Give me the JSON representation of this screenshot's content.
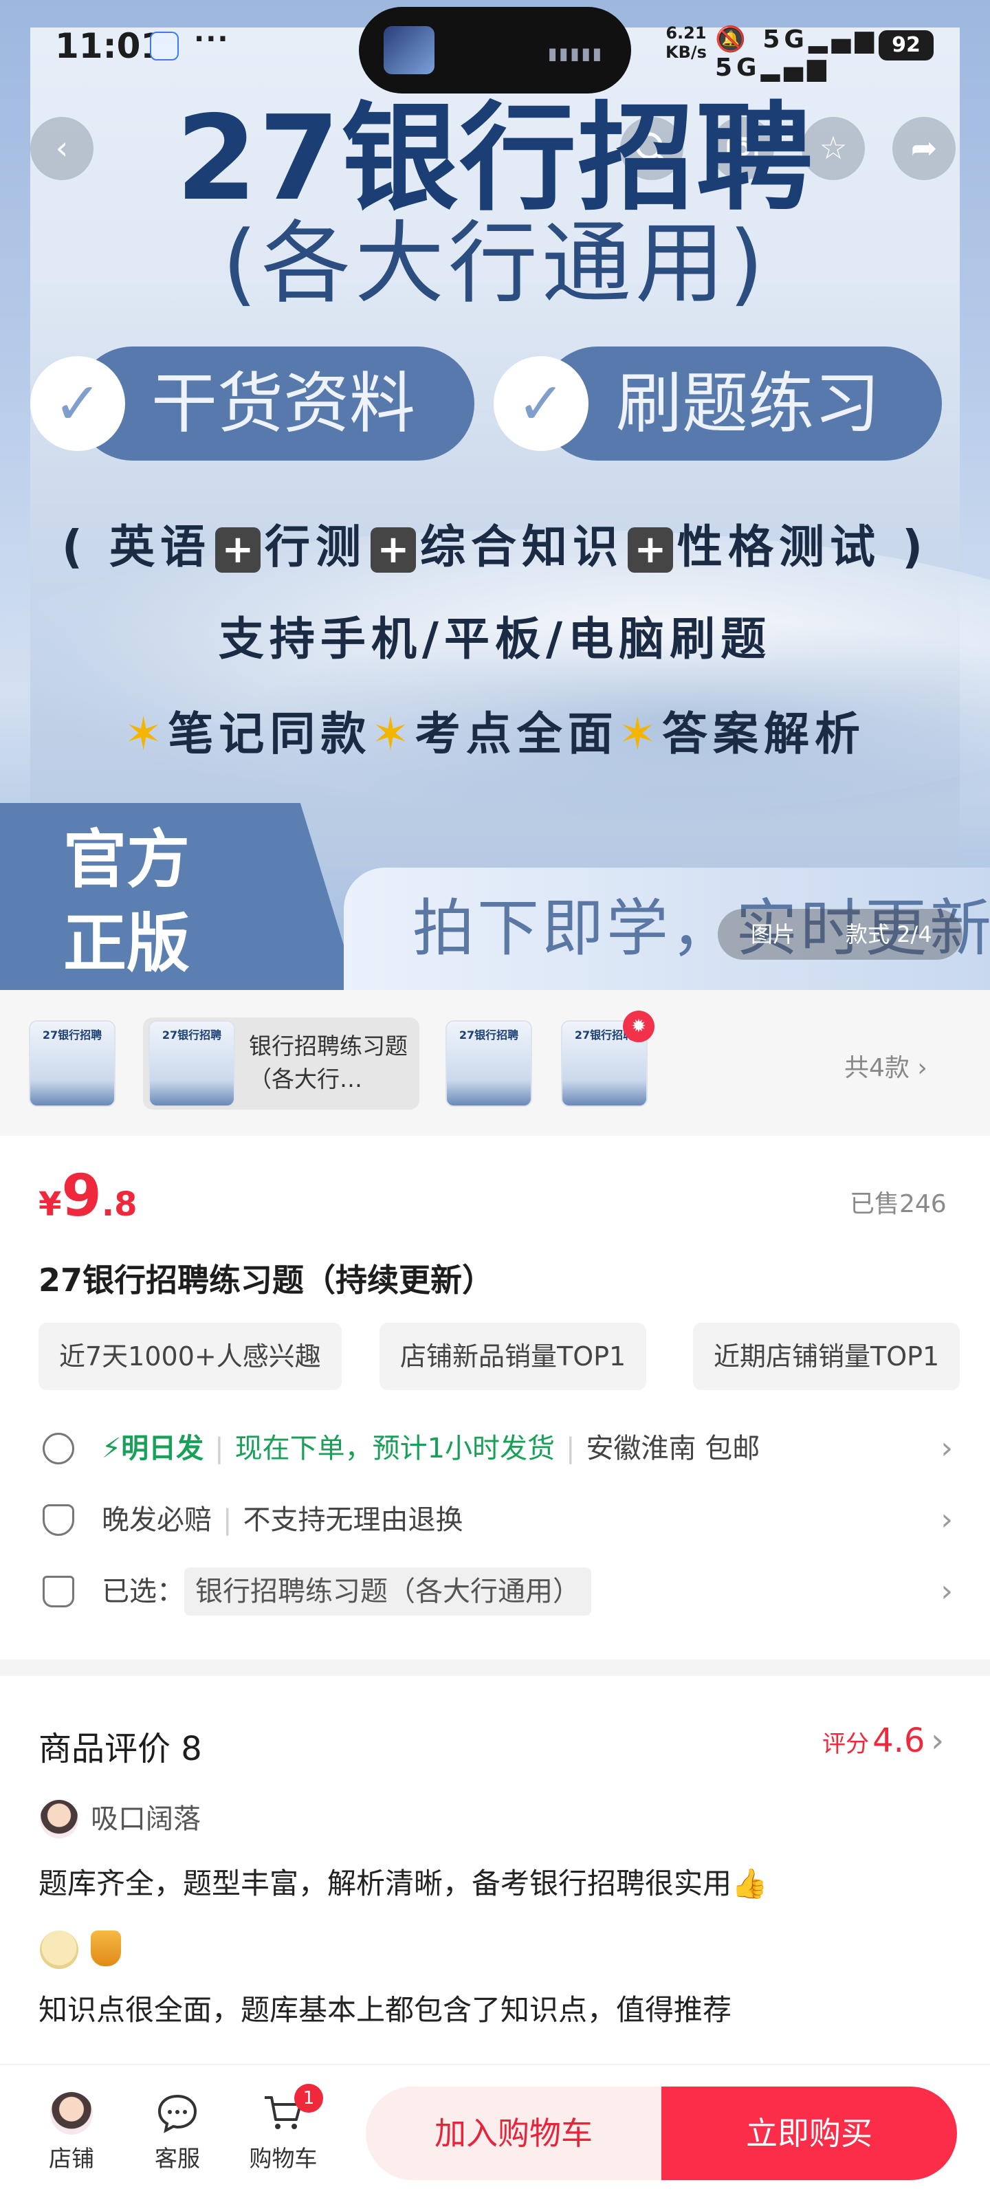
{
  "status_bar": {
    "time": "11:01",
    "dots": "···",
    "net_speed_value": "6.21",
    "net_speed_unit": "KB/s",
    "signal_1": "5G",
    "signal_2": "5G",
    "battery": "92"
  },
  "hero": {
    "title": "27银行招聘",
    "subtitle": "(各大行通用)",
    "pill_1": "干货资料",
    "pill_2": "刷题练习",
    "subjects": [
      "英语",
      "行测",
      "综合知识",
      "性格测试"
    ],
    "subjects_open": "(",
    "subjects_close": ")",
    "devices": "支持手机/平板/电脑刷题",
    "features": [
      "笔记同款",
      "考点全面",
      "答案解析"
    ],
    "badge_line_1": "官方",
    "badge_line_2": "正版",
    "banner": "拍下即学，实时更新",
    "counter_tab": "图片",
    "counter_text": "款式 2/4"
  },
  "variants": {
    "thumb_title": "27银行招聘",
    "selected_label": "银行招聘练习题（各大行…",
    "count_label": "共4款"
  },
  "product": {
    "currency": "¥",
    "price_int": "9",
    "price_dec": ".8",
    "sold": "已售246",
    "title": "27银行招聘练习题（持续更新）",
    "tags": [
      "近7天1000+人感兴趣",
      "店铺新品销量TOP1",
      "近期店铺销量TOP1"
    ]
  },
  "shipping": {
    "ship_label": "明日发",
    "ship_note": "现在下单，预计1小时发货",
    "origin": "安徽淮南 包邮",
    "guarantee_1": "晚发必赔",
    "guarantee_2": "不支持无理由退换",
    "selected_prefix": "已选：",
    "selected_value": "银行招聘练习题（各大行通用）"
  },
  "reviews": {
    "heading": "商品评价 8",
    "score_label": "评分",
    "score": "4.6",
    "reviewer_1": "吸口阔落",
    "review_1": "题库齐全，题型丰富，解析清晰，备考银行招聘很实用👍",
    "review_2": "知识点很全面，题库基本上都包含了知识点，值得推荐"
  },
  "bottom_bar": {
    "shop": "店铺",
    "service": "客服",
    "cart": "购物车",
    "cart_badge": "1",
    "add_to_cart": "加入购物车",
    "buy_now": "立即购买"
  },
  "colors": {
    "accent_red": "#f0283c",
    "ship_green": "#18a058",
    "hero_blue": "#1b3f74"
  }
}
